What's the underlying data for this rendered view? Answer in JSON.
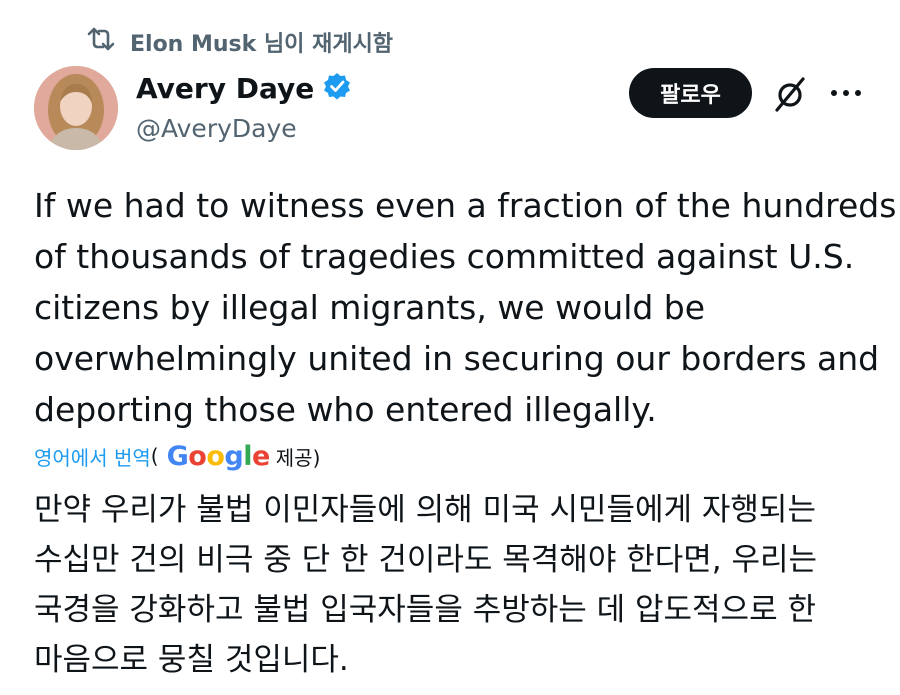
{
  "repost": {
    "text": "Elon Musk 님이 재게시함",
    "icon": "repost-icon"
  },
  "author": {
    "display_name": "Avery Daye",
    "handle": "@AveryDaye",
    "verified": true,
    "verified_color": "#1d9bf0"
  },
  "actions": {
    "follow_label": "팔로우",
    "grok_icon": "grok-icon",
    "more_icon": "more-icon"
  },
  "tweet": {
    "lines": [
      "If we had to witness even a fraction of the hundreds",
      "of thousands of tragedies committed against U.S.",
      "citizens by illegal migrants, we would be",
      "overwhelmingly united in securing our borders and",
      "deporting those who entered illegally."
    ]
  },
  "translation": {
    "link_label": "영어에서 번역",
    "open_paren": "(",
    "provider": "Google",
    "provider_colors": [
      "#4285F4",
      "#EA4335",
      "#FBBC05",
      "#4285F4",
      "#34A853",
      "#EA4335"
    ],
    "provided_label": "제공)",
    "lines": [
      "만약 우리가 불법 이민자들에 의해 미국 시민들에게 자행되는",
      "수십만 건의 비극 중 단 한 건이라도 목격해야 한다면, 우리는",
      "국경을 강화하고 불법 입국자들을 추방하는 데 압도적으로 한",
      "마음으로 뭉칠 것입니다."
    ]
  },
  "colors": {
    "text": "#0f1419",
    "secondary": "#536471",
    "link": "#1d9bf0"
  }
}
